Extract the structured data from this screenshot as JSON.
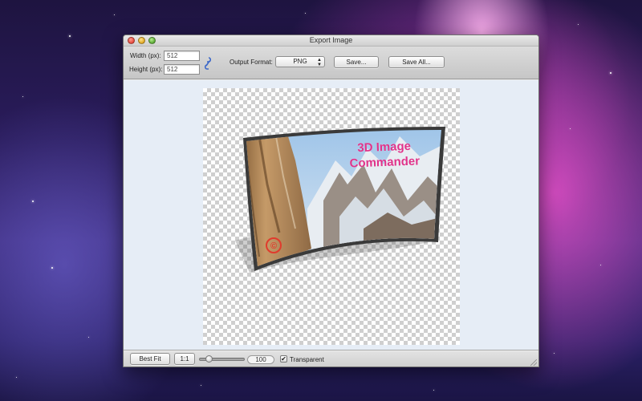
{
  "window": {
    "title": "Export Image"
  },
  "toolbar": {
    "width_label": "Width (px):",
    "width_value": "512",
    "height_label": "Height (px):",
    "height_value": "512",
    "link_icon": "chain-link-icon",
    "format_label": "Output Format:",
    "format_value": "PNG",
    "save_label": "Save...",
    "save_all_label": "Save All..."
  },
  "preview": {
    "text_line1": "3D Image",
    "text_line2": "Commander",
    "text_color": "#e0338a"
  },
  "bottombar": {
    "best_fit_label": "Best Fit",
    "one_to_one_label": "1:1",
    "zoom_value": "100",
    "zoom_fraction": 0.15,
    "transparent_label": "Transparent",
    "transparent_checked": "✔"
  }
}
